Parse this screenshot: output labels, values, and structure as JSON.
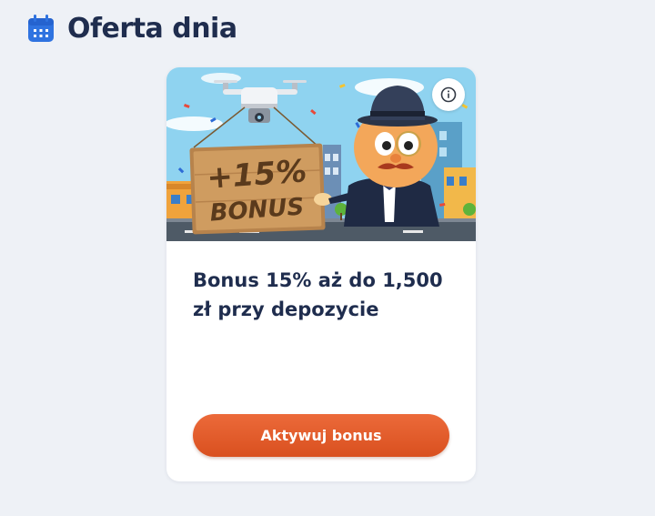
{
  "header": {
    "title": "Oferta dnia",
    "icon": "calendar-icon"
  },
  "offer": {
    "banner": {
      "sign_line1": "+15%",
      "sign_line2": "BONUS"
    },
    "info_icon": "info-icon",
    "title": "Bonus 15% aż do 1,500 zł przy depozycie",
    "button_label": "Aktywuj bonus"
  },
  "colors": {
    "accent": "#e35d2b",
    "title_text": "#1f2d4e",
    "calendar_icon": "#2f73e0",
    "background": "#eef1f6"
  }
}
